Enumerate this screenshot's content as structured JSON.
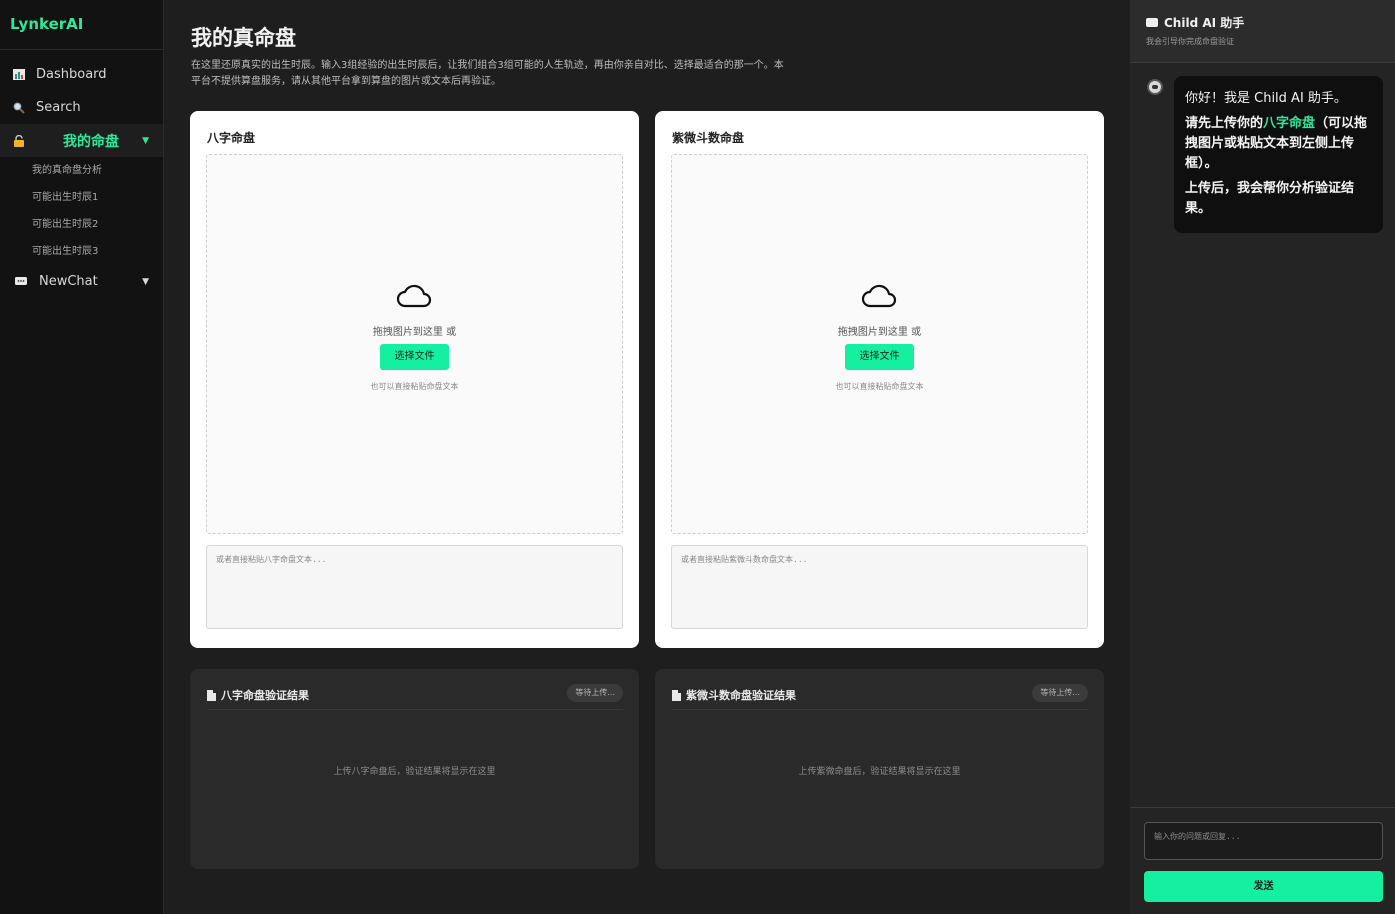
{
  "brand": "LynkerAI",
  "nav": {
    "dashboard": "Dashboard",
    "search": "Search",
    "my_chart": "我的命盘",
    "sub_items": [
      "我的真命盘分析",
      "可能出生时辰1",
      "可能出生时辰2",
      "可能出生时辰3"
    ],
    "newchat": "NewChat",
    "caret": "▼"
  },
  "page": {
    "title": "我的真命盘",
    "description": "在这里还原真实的出生时辰。输入3组经验的出生时辰后，让我们组合3组可能的人生轨迹，再由你亲自对比、选择最适合的那一个。本平台不提供算盘服务，请从其他平台拿到算盘的图片或文本后再验证。"
  },
  "cards": [
    {
      "title": "八字命盘",
      "drop_text": "拖拽图片到这里 或",
      "choose_label": "选择文件",
      "hint": "也可以直接粘贴命盘文本",
      "paste_placeholder": "或者直接粘贴八字命盘文本..."
    },
    {
      "title": "紫微斗数命盘",
      "drop_text": "拖拽图片到这里 或",
      "choose_label": "选择文件",
      "hint": "也可以直接粘贴命盘文本",
      "paste_placeholder": "或者直接粘贴紫微斗数命盘文本..."
    }
  ],
  "results": [
    {
      "title": "八字命盘验证结果",
      "status": "等待上传...",
      "empty": "上传八字命盘后，验证结果将显示在这里"
    },
    {
      "title": "紫微斗数命盘验证结果",
      "status": "等待上传...",
      "empty": "上传紫微命盘后，验证结果将显示在这里"
    }
  ],
  "chat": {
    "title": "Child AI 助手",
    "subtitle": "我会引导你完成命盘验证",
    "msg_line1": "你好！我是 Child AI 助手。",
    "msg_line2_a": "请先上传你的",
    "msg_line2_hl": "八字命盘",
    "msg_line2_b": "（可以拖拽图片或粘贴文本到左侧上传框）。",
    "msg_line3": "上传后，我会帮你分析验证结果。",
    "input_placeholder": "输入你的问题或回复...",
    "send_label": "发送"
  },
  "icons": {
    "dashboard": "bar-chart-icon",
    "search": "magnifier-icon",
    "my_chart": "lock-icon",
    "newchat": "chat-bubble-icon",
    "upload": "cloud-icon",
    "result": "document-icon"
  },
  "colors": {
    "accent": "#14f0a0",
    "brand": "#2ee89a",
    "sidebar_bg": "#121212",
    "main_bg": "#1e1e1e"
  }
}
